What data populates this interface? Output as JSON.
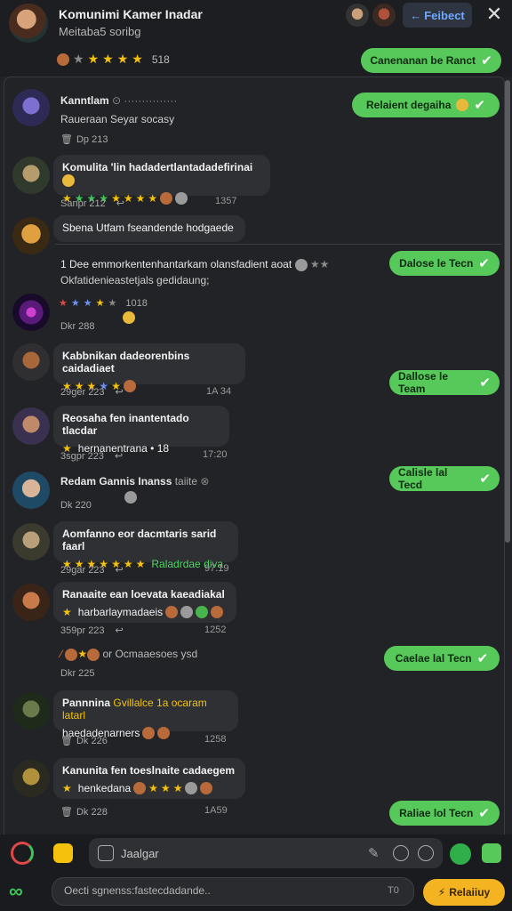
{
  "header": {
    "title": "Komunimi Kamer Inadar",
    "subtitle": "Meitaba5 soribg",
    "rating_text": "518",
    "follow_label": "Feibect",
    "close_label": "✕"
  },
  "pills": [
    {
      "label": "Canenanan  be Ranct"
    },
    {
      "label": "Relaient degaiha"
    },
    {
      "label": "Dalose le Tecn"
    },
    {
      "label": "Dallose le Team"
    },
    {
      "label": "Calisle lal Tecd"
    },
    {
      "label": "Caelae lal Tecn"
    },
    {
      "label": "Raliae lol Tecn"
    }
  ],
  "messages": [
    {
      "name": "Kanntlam",
      "text": "Raueraan Seyar socasy",
      "meta": "Dp  213"
    },
    {
      "name": "Komulita 'lin hadadertlantadadefirinai",
      "meta": "Sanpr  212",
      "time": "1357"
    },
    {
      "name": "Sbena Utfam fseandende hodgaede"
    },
    {
      "line1": "1  Dee emmorkentenhantarkam olansfadient aoat",
      "line2": "Okfatidenieastetjals gedidaung;",
      "meta": "Dkr  288"
    },
    {
      "name": "Kabbnikan dadeorenbins caidadiaet",
      "meta": "29ger  223",
      "time": "1A 34"
    },
    {
      "name": "Reosaha  fen inantentado tlacdar",
      "sub": "hernanentrana • 18",
      "meta": "3sgpr  223",
      "time": "17:20"
    },
    {
      "name": "Redam Gannis Inanss",
      "tail": "taiite",
      "meta": "Dk  220"
    },
    {
      "name": "Aomfanno eor dacmtaris sarid faarl",
      "sub": "Raladrdae diva",
      "meta": "29gar  223",
      "time": "97.19"
    },
    {
      "name": "Ranaaite  ean loevata kaeadiakal",
      "sub": "harbarlaymadaeis",
      "meta": "359pr  223",
      "time": "1252"
    },
    {
      "line1": "or Ocmaaesoes ysd",
      "meta": "Dkr  225"
    },
    {
      "name": "Pannnina",
      "highlight": "Gvillalce 1a ocaram latarl",
      "sub": "haedadenarners",
      "meta": "Dk  226",
      "time": "1258"
    },
    {
      "name": "Kanunita  fen toeslnaite cadaegem",
      "sub": "henkedana",
      "meta": "Dk  228",
      "time": "1A59"
    }
  ],
  "composer": {
    "placeholder": "Jaalgar",
    "input_text": "Oecti sgnenss:fastecdadande..",
    "count": "T0",
    "send_label": "Relaiiuy"
  },
  "colors": {
    "accent_green": "#57c85a",
    "send_yellow": "#f4b320",
    "follow_blue": "#6ea8ff"
  }
}
